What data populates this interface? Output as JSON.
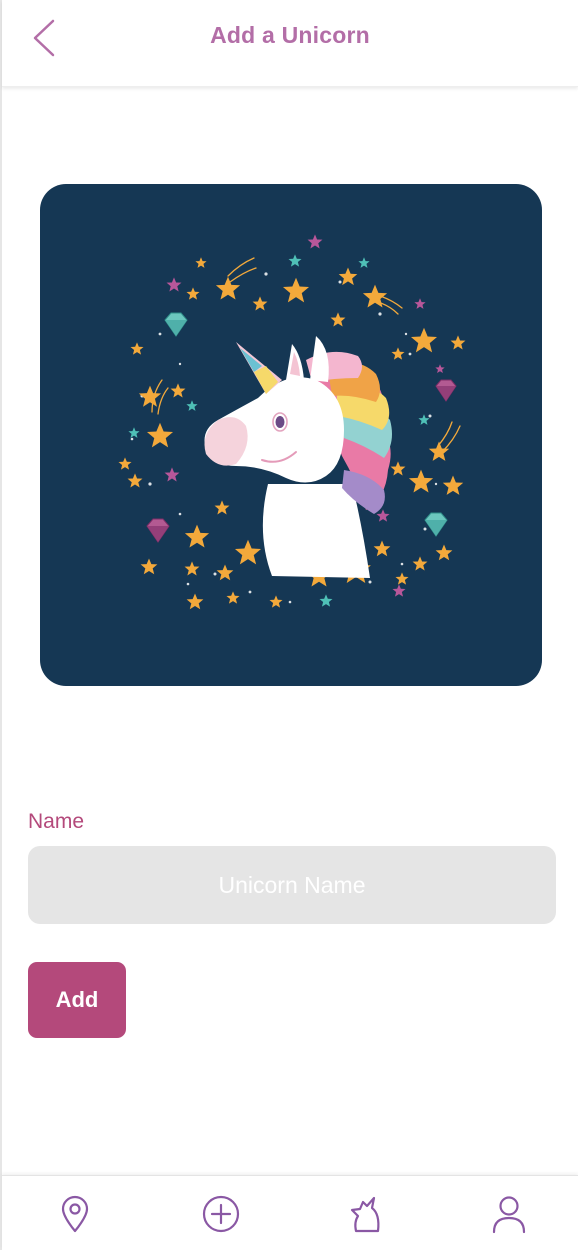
{
  "header": {
    "title": "Add a Unicorn",
    "back_icon": "chevron-left-icon"
  },
  "hero": {
    "image": "unicorn-illustration",
    "background_color": "#153754"
  },
  "form": {
    "name_label": "Name",
    "name_value": "",
    "name_placeholder": "Unicorn Name",
    "add_label": "Add"
  },
  "nav": {
    "items": [
      {
        "icon": "location-pin-icon"
      },
      {
        "icon": "plus-circle-icon"
      },
      {
        "icon": "unicorn-icon"
      },
      {
        "icon": "user-icon"
      }
    ]
  },
  "colors": {
    "accent": "#b4497b",
    "title": "#b36ea7",
    "nav_icon": "#8a58a4",
    "input_bg": "#e5e5e5"
  }
}
